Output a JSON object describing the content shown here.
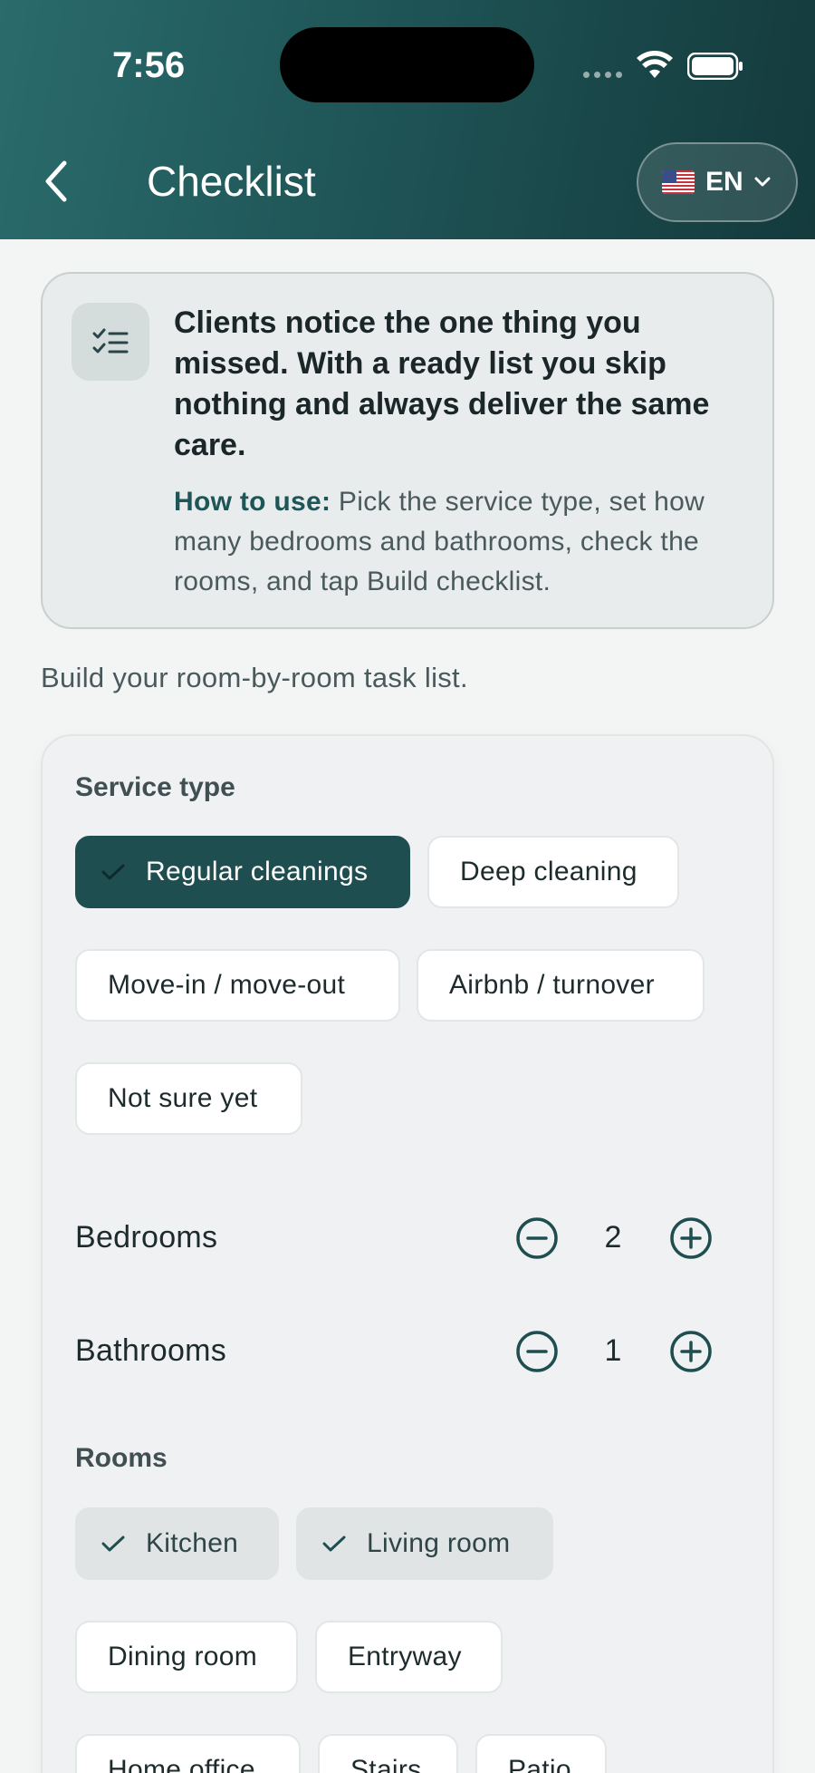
{
  "status_bar": {
    "time": "7:56"
  },
  "header": {
    "title": "Checklist",
    "language": "EN"
  },
  "info_card": {
    "headline": "Clients notice the one thing you missed. With a ready list you skip nothing and always deliver the same care.",
    "howto_label": "How to use:",
    "howto_text": " Pick the service type, set how many bedrooms and bathrooms, check the rooms, and tap Build checklist."
  },
  "intro": "Build your room-by-room task list.",
  "service": {
    "label": "Service type",
    "options": [
      "Regular cleanings",
      "Deep cleaning",
      "Move-in / move-out",
      "Airbnb / turnover",
      "Not sure yet"
    ],
    "selected": "Regular cleanings"
  },
  "bedrooms": {
    "label": "Bedrooms",
    "value": "2"
  },
  "bathrooms": {
    "label": "Bathrooms",
    "value": "1"
  },
  "rooms": {
    "label": "Rooms",
    "options": [
      "Kitchen",
      "Living room",
      "Dining room",
      "Entryway",
      "Home office",
      "Stairs",
      "Patio"
    ],
    "selected": [
      "Kitchen",
      "Living room"
    ]
  },
  "colors": {
    "header": "#1f5557",
    "accent": "#1f4e50",
    "background": "#f3f4f4"
  }
}
